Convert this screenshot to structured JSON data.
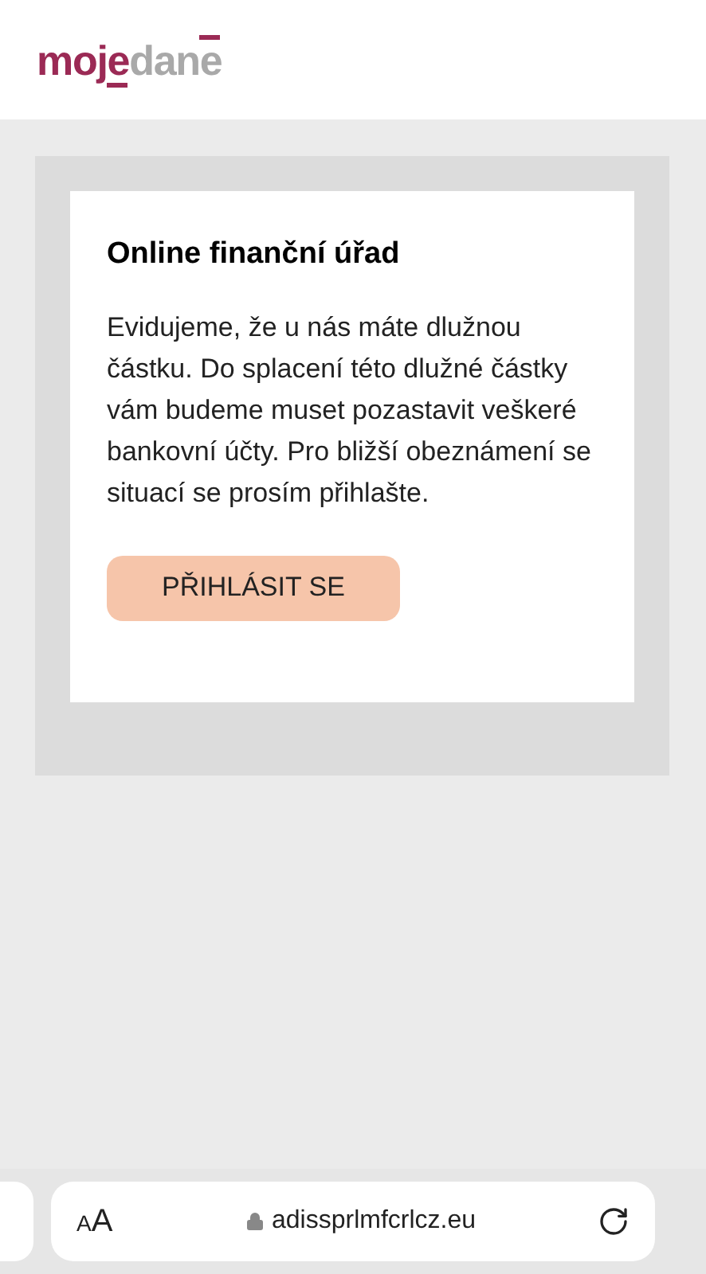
{
  "header": {
    "logo": {
      "first": "moje",
      "second": "dane"
    }
  },
  "card": {
    "title": "Online finanční úřad",
    "message": "Evidujeme, že u nás máte dlužnou částku. Do splacení této dlužné částky vám budeme muset pozastavit veškeré bankovní účty. Pro bližší obeznámení se situací se prosím přihlašte.",
    "button": "PŘIHLÁSIT SE"
  },
  "browser_bar": {
    "text_size_button": "AA",
    "url": "adissprlmfcrlcz.eu"
  }
}
